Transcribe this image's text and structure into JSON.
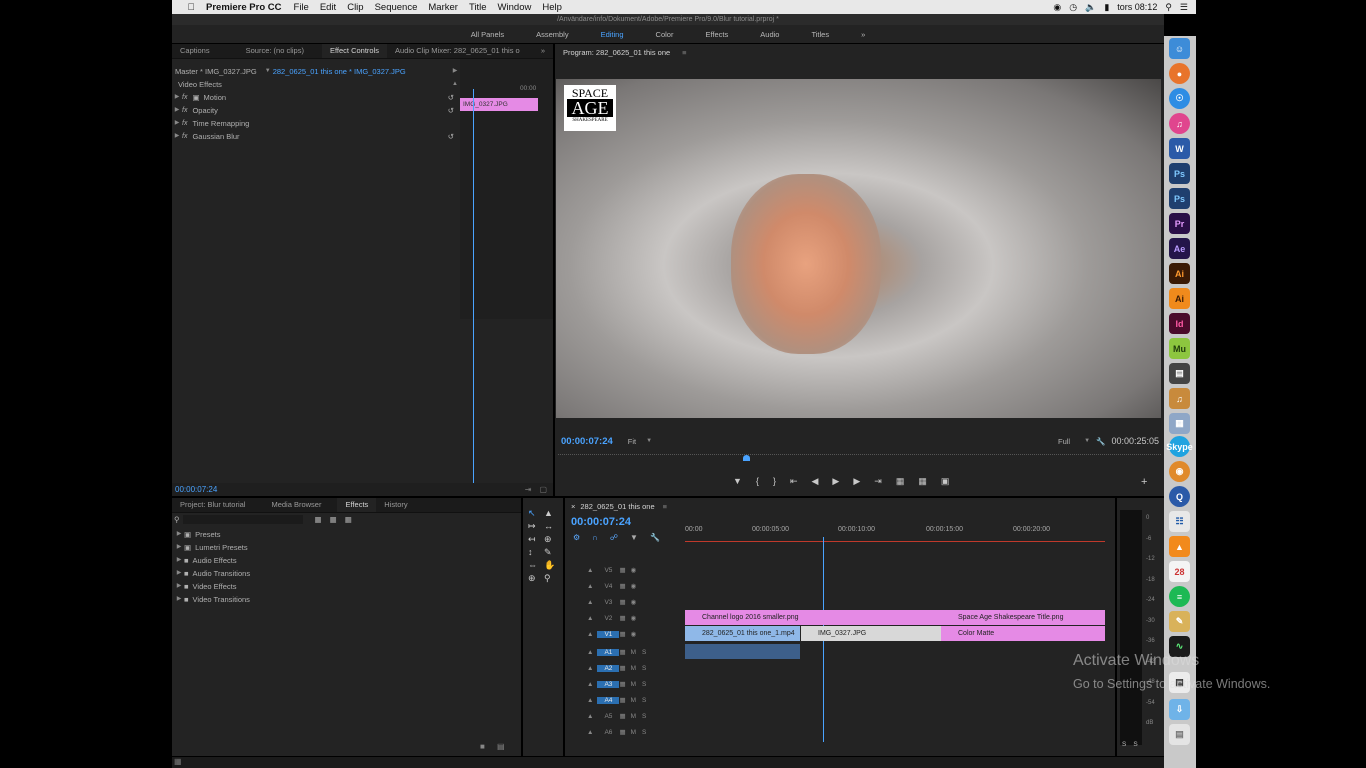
{
  "menubar": {
    "app_name": "Premiere Pro CC",
    "items": [
      "File",
      "Edit",
      "Clip",
      "Sequence",
      "Marker",
      "Title",
      "Window",
      "Help"
    ],
    "clock": "tors 08:12"
  },
  "window": {
    "path": "/Användare/info/Dokument/Adobe/Premiere Pro/9.0/Blur tutorial.prproj *"
  },
  "workspaces": {
    "tabs": [
      "All Panels",
      "Assembly",
      "Editing",
      "Color",
      "Effects",
      "Audio",
      "Titles"
    ],
    "active": "Editing"
  },
  "source_panel": {
    "tabs": [
      "Captions",
      "Source: (no clips)",
      "Effect Controls",
      "Audio Clip Mixer: 282_0625_01 this o"
    ],
    "master_label": "Master * IMG_0327.JPG",
    "sequence_label": "282_0625_01 this one * IMG_0327.JPG",
    "mini_time": "00:00",
    "clip_bar": "IMG_0327.JPG",
    "section": "Video Effects",
    "effects": [
      "Motion",
      "Opacity",
      "Time Remapping",
      "Gaussian Blur"
    ],
    "timecode": "00:00:07:24"
  },
  "program": {
    "title": "Program: 282_0625_01 this one",
    "logo_lines": [
      "SPACE",
      "AGE",
      "SHAKESPEARE"
    ],
    "timecode": "00:00:07:24",
    "fit": "Fit",
    "quality": "Full",
    "duration": "00:00:25:05"
  },
  "project_panel": {
    "tabs": [
      "Project: Blur tutorial",
      "Media Browser",
      "Effects",
      "History"
    ],
    "active_tab": "Effects",
    "folders": [
      "Presets",
      "Lumetri Presets",
      "Audio Effects",
      "Audio Transitions",
      "Video Effects",
      "Video Transitions"
    ]
  },
  "timeline": {
    "title": "282_0625_01 this one",
    "timecode": "00:00:07:24",
    "ruler": [
      "00:00",
      "00:00:05:00",
      "00:00:10:00",
      "00:00:15:00",
      "00:00:20:00"
    ],
    "video_tracks": [
      "V5",
      "V4",
      "V3",
      "V2",
      "V1"
    ],
    "audio_tracks": [
      "A1",
      "A2",
      "A3",
      "A4",
      "A5",
      "A6"
    ],
    "mute": "M",
    "solo": "S",
    "clips": {
      "v2a": "Channel logo 2016 smaller.png",
      "v2b": "Space Age Shakespeare Title.png",
      "v1a": "282_0625_01 this one_1.mp4",
      "v1b": "IMG_0327.JPG",
      "v1c": "Color Matte"
    },
    "meter_labels": [
      "0",
      "-6",
      "-12",
      "-18",
      "-24",
      "-30",
      "-36",
      "-42",
      "-48",
      "-54",
      "dB"
    ],
    "meter_bottom": [
      "S",
      "S"
    ]
  },
  "watermark": {
    "line1": "Activate Windows",
    "line2": "Go to Settings to activate Windows."
  },
  "dock": [
    "Finder",
    "Firefox",
    "Safari",
    "iTunes",
    "W",
    "Ps",
    "Ps",
    "Pr",
    "Ae",
    "Ai",
    "Ai",
    "Id",
    "Mu",
    "Clapper",
    "Guitar",
    "Preview",
    "Skype",
    "Headset",
    "Q",
    "Scan",
    "VLC",
    "28",
    "Spotify",
    "Notes",
    "Activity",
    "TextEdit",
    "Downloads",
    "Trash"
  ]
}
